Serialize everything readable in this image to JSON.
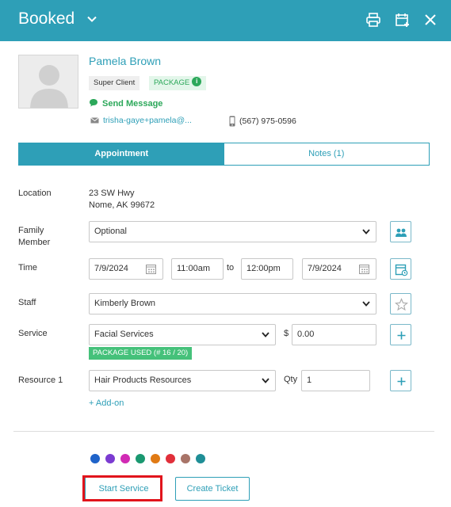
{
  "header": {
    "title": "Booked",
    "icons": [
      "chevron-down-icon",
      "print-icon",
      "calendar-add-icon",
      "close-icon"
    ]
  },
  "client": {
    "name": "Pamela Brown",
    "tag_super": "Super Client",
    "tag_package": "PACKAGE",
    "info_glyph": "i",
    "send_message": "Send Message",
    "email": "trisha-gaye+pamela@...",
    "phone": "(567) 975-0596"
  },
  "tabs": [
    {
      "label": "Appointment",
      "active": true
    },
    {
      "label": "Notes (1)",
      "active": false
    }
  ],
  "form": {
    "location_label": "Location",
    "location_line1": "23 SW Hwy",
    "location_line2": "Nome, AK 99672",
    "family_label_1": "Family",
    "family_label_2": "Member",
    "family_value": "Optional",
    "time_label": "Time",
    "start_date": "7/9/2024",
    "start_time": "11:00am",
    "to_text": "to",
    "end_time": "12:00pm",
    "end_date": "7/9/2024",
    "staff_label": "Staff",
    "staff_value": "Kimberly Brown",
    "service_label": "Service",
    "service_value": "Facial Services",
    "currency": "$",
    "price": "0.00",
    "package_used": "PACKAGE USED (# 16 / 20)",
    "resource_label": "Resource 1",
    "resource_value": "Hair Products Resources",
    "qty_label": "Qty",
    "qty_value": "1",
    "addon": "+ Add-on"
  },
  "colors": {
    "accent": "#2e9fb7",
    "success": "#2ca85a",
    "highlight": "#e1141c",
    "palette": [
      "#1f63c9",
      "#7b3bd1",
      "#d12ab4",
      "#1a9870",
      "#e07a14",
      "#e12f3a",
      "#a87468",
      "#1f8e96"
    ]
  },
  "actions": {
    "start_service": "Start Service",
    "create_ticket": "Create Ticket"
  }
}
